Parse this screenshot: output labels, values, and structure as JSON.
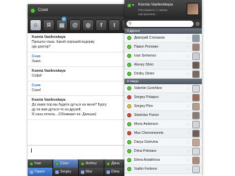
{
  "chat": {
    "title": "Соня",
    "toolbar": [
      {
        "label": "",
        "icon": "smiley-icon"
      },
      {
        "label": "Я",
        "icon": "yandex-icon"
      },
      {
        "label": "",
        "icon": "files-icon",
        "badge": "5"
      },
      {
        "label": "@",
        "icon": "mail-icon"
      },
      {
        "label": "",
        "icon": "vk-icon"
      },
      {
        "label": "f",
        "icon": "facebook-icon"
      },
      {
        "label": "",
        "icon": "twitter-icon"
      },
      {
        "label": "",
        "icon": "music-icon"
      }
    ],
    "messages": [
      {
        "author": "Ksenia Vasilevskaya",
        "me": false,
        "lines": [
          "Прошла глаза. Какой хороший всдорву",
          "где доктор?"
        ]
      },
      {
        "author": "Соня",
        "me": true,
        "lines": [
          "Ушел."
        ]
      },
      {
        "author": "Ksenia Vasilevskaya",
        "me": false,
        "lines": [
          "Софи!"
        ]
      },
      {
        "author": "Соня",
        "me": true,
        "lines": [
          "Соня!"
        ]
      },
      {
        "author": "Ksenia Vasilevskaya",
        "me": false,
        "lines": [
          "До каких пор вы будете дуться на меня? Бургу",
          "ду не вам дуться-то на друзей.",
          "Я сана хотела... (Обнимает ее. Дальше)"
        ]
      }
    ]
  },
  "bottom_tabs": {
    "row1": [
      {
        "label": "Ivan",
        "status": "green",
        "state": "normal"
      },
      {
        "label": "Соня",
        "status": "green",
        "state": "active"
      },
      {
        "label": "Andrey",
        "status": "green",
        "state": "normal"
      },
      {
        "label": "Дина",
        "status": "green",
        "state": "normal"
      }
    ],
    "row2": [
      {
        "label": "Павел",
        "status": "ico",
        "state": "blue"
      },
      {
        "label": "Sergey",
        "status": "ico",
        "state": "normal"
      },
      {
        "label": "Max",
        "status": "ico",
        "state": "normal"
      },
      {
        "label": "Dima",
        "status": "ico",
        "state": "normal"
      }
    ]
  },
  "roster": {
    "user_name": "Ksenia Vasilevskaya",
    "status_message": "Расскажите о своем настроении...",
    "search_placeholder": "",
    "groups": [
      {
        "name": "Друзья",
        "contacts": [
          {
            "name": "Дмитрий Степанов",
            "status": "green",
            "avatar": "#8c9aa6"
          },
          {
            "name": "Павел Рогожин",
            "status": "green",
            "avatar": "#a08070"
          },
          {
            "name": "Ivan Semenov",
            "status": "green",
            "avatar": "#c9cfd4"
          },
          {
            "name": "Alexey Shiro",
            "status": "green",
            "avatar": "#6a5a50"
          },
          {
            "name": "Dmitry Ziimin",
            "status": "green",
            "avatar": "#7a6a5e"
          }
        ]
      },
      {
        "name": "Авидо",
        "contacts": [
          {
            "name": "Valentin Gorshkov",
            "status": "green",
            "avatar": "#d6dade"
          },
          {
            "name": "Sergey Potapov",
            "status": "red",
            "avatar": "#9a6a5a"
          },
          {
            "name": "Sergey Ptov",
            "status": "yellow",
            "avatar": "#b89a88"
          },
          {
            "name": "Stanislav Panov",
            "status": "red",
            "avatar": "#8a7a70"
          },
          {
            "name": "Mons Anderson",
            "status": "green",
            "avatar": "#d0d4d8"
          },
          {
            "name": "Max Chernomorets",
            "status": "red",
            "avatar": "#6e5e58"
          },
          {
            "name": "Darya Golovina",
            "status": "green",
            "avatar": "#c4a490"
          },
          {
            "name": "Dima Poletaev",
            "status": "green",
            "avatar": "#d6dade"
          },
          {
            "name": "Elena Astakhova",
            "status": "green",
            "avatar": "#b08878"
          },
          {
            "name": "Vadim Fedorov",
            "status": "green",
            "avatar": "#d6dade"
          }
        ]
      }
    ]
  }
}
